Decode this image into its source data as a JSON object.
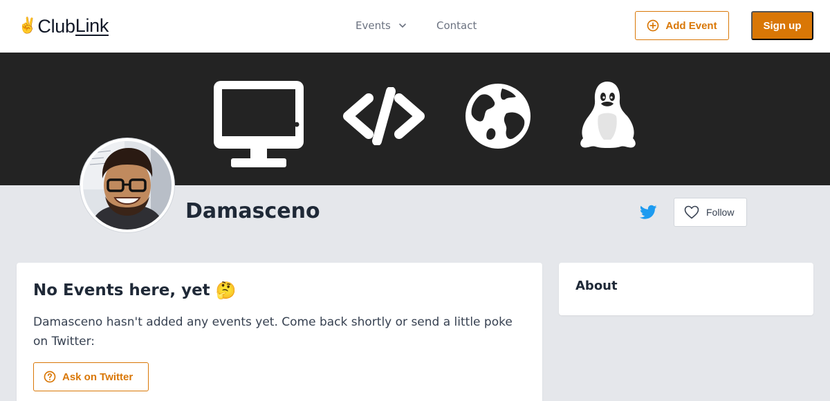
{
  "header": {
    "logo_emoji": "✌️",
    "logo_text_a": "Club",
    "logo_text_b": "Link",
    "nav": {
      "events_label": "Events",
      "contact_label": "Contact"
    },
    "add_event_label": "Add Event",
    "signup_label": "Sign up"
  },
  "banner": {
    "icons": [
      "monitor-icon",
      "code-icon",
      "globe-icon",
      "tux-icon"
    ]
  },
  "profile": {
    "name": "Damasceno",
    "twitter_icon": "twitter-icon",
    "follow_label": "Follow"
  },
  "events_card": {
    "title": "No Events here, yet",
    "title_emoji": "🤔",
    "description": "Damasceno hasn't added any events yet. Come back shortly or send a little poke on Twitter:",
    "ask_label": "Ask on Twitter"
  },
  "about_card": {
    "title": "About"
  },
  "colors": {
    "accent": "#d97706",
    "banner_bg": "#232323",
    "page_bg": "#e5e7eb",
    "twitter": "#1d9bf0"
  }
}
